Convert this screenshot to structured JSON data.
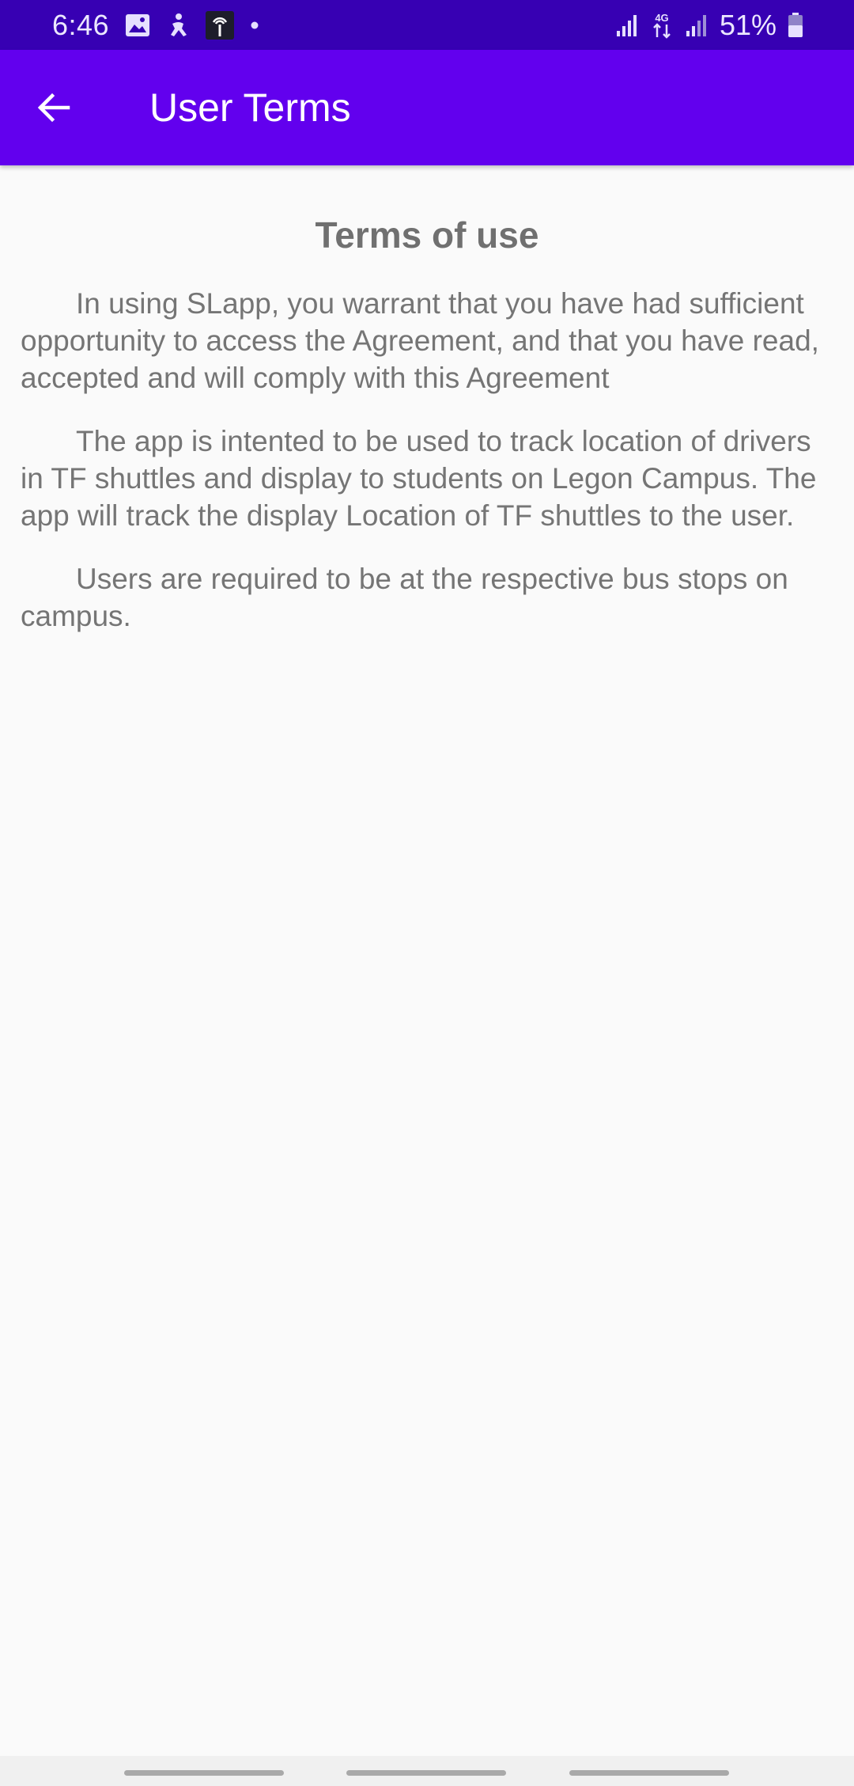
{
  "status_bar": {
    "time": "6:46",
    "network_type": "4G",
    "battery": "51%",
    "icons": [
      "image-icon",
      "accessibility-icon",
      "hotspot-icon",
      "dot-icon",
      "signal-icon",
      "data-arrows-icon",
      "signal-icon",
      "battery-icon"
    ]
  },
  "app_bar": {
    "title": "User Terms",
    "back_icon": "arrow-back-icon",
    "color": "#6200ee"
  },
  "terms": {
    "heading": "Terms of use",
    "paragraphs": [
      "In using SLapp, you warrant that you have had sufficient opportunity to access the Agreement, and that you have read, accepted and will comply with this Agreement",
      "The app is intented to be used to track location of drivers in TF shuttles and display to students on Legon Campus. The app will track the display Location of TF shuttles to the user.",
      "Users are required to be at the respective bus stops on campus."
    ]
  },
  "colors": {
    "status_bar": "#3700b3",
    "app_bar": "#6200ee",
    "background": "#fafafa",
    "text": "#757575"
  }
}
